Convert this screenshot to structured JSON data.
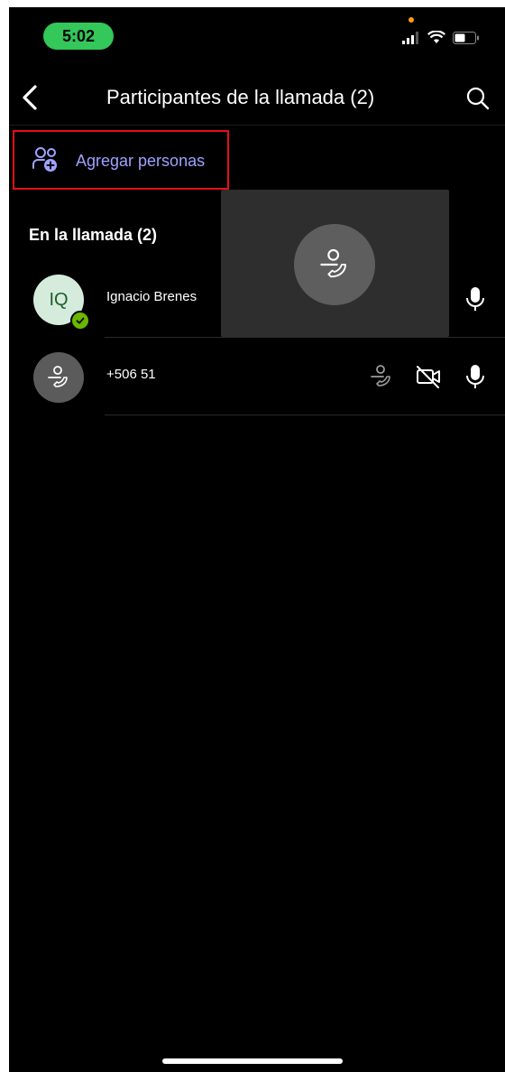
{
  "status_bar": {
    "time": "5:02"
  },
  "header": {
    "title": "Participantes de la llamada (2)"
  },
  "add_people": {
    "label": "Agregar personas"
  },
  "section": {
    "title": "En la llamada (2)"
  },
  "participants": [
    {
      "initials": "IQ",
      "name": "Ignacio Brenes",
      "icons": [
        "microphone-icon"
      ]
    },
    {
      "initials": "",
      "name": "+506 51",
      "icons": [
        "phone-call-icon",
        "video-off-icon",
        "microphone-icon"
      ]
    }
  ],
  "colors": {
    "accent": "#9ea2ff",
    "highlight_border": "#e3101a",
    "status_time_bg": "#34c759",
    "presence": "#6bb700"
  }
}
